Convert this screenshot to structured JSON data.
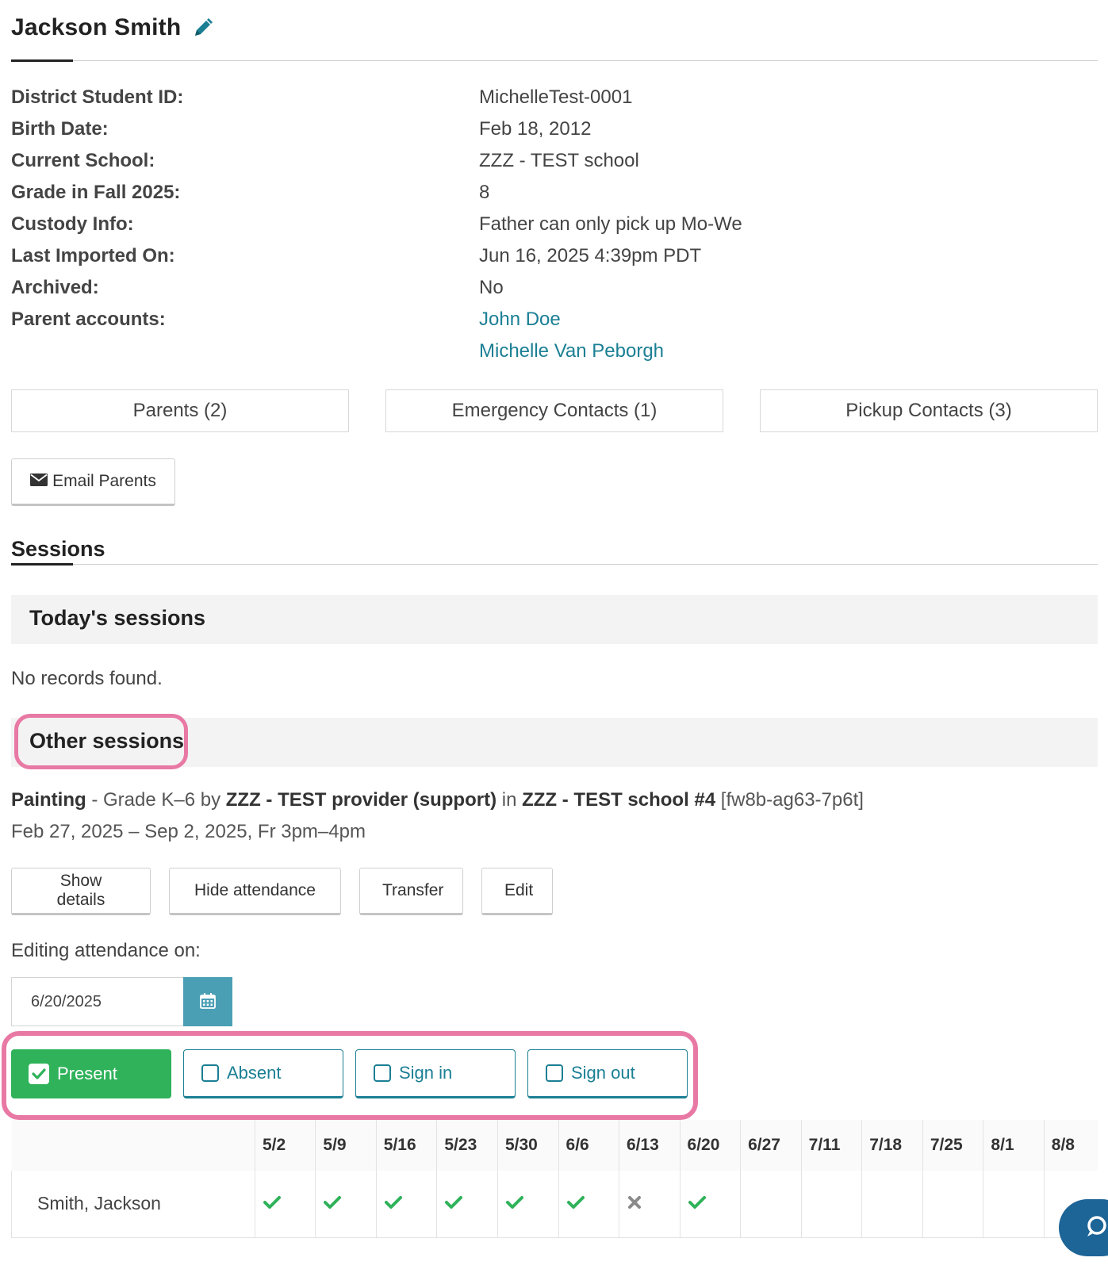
{
  "student": {
    "name": "Jackson Smith",
    "edit_icon": "pencil-icon",
    "fields": [
      {
        "label": "District Student ID:",
        "value": "MichelleTest-0001"
      },
      {
        "label": "Birth Date:",
        "value": "Feb 18, 2012"
      },
      {
        "label": "Current School:",
        "value": "ZZZ - TEST school"
      },
      {
        "label": "Grade in Fall 2025:",
        "value": "8"
      },
      {
        "label": "Custody Info:",
        "value": "Father can only pick up Mo-We"
      },
      {
        "label": "Last Imported On:",
        "value": "Jun 16, 2025 4:39pm PDT"
      },
      {
        "label": "Archived:",
        "value": "No"
      }
    ],
    "parent_accounts_label": "Parent accounts:",
    "parent_accounts": [
      "John Doe",
      "Michelle Van Peborgh"
    ]
  },
  "tabs": [
    "Parents (2)",
    "Emergency Contacts (1)",
    "Pickup Contacts (3)"
  ],
  "email_parents_label": "Email Parents",
  "sessions": {
    "title": "Sessions",
    "today_title": "Today's sessions",
    "no_records": "No records found.",
    "other_title": "Other sessions",
    "session": {
      "name": "Painting",
      "grade": " - Grade K–6 by ",
      "provider": "ZZZ - TEST provider (support)",
      "in_text": " in ",
      "school": "ZZZ - TEST school #4",
      "code": " [fw8b-ag63-7p6t]",
      "schedule": "Feb 27, 2025 – Sep 2, 2025, Fr 3pm–4pm"
    },
    "buttons": [
      "Show details",
      "Hide attendance",
      "Transfer",
      "Edit"
    ],
    "editing_label": "Editing attendance on:",
    "date_value": "6/20/2025",
    "attendance_options": [
      {
        "label": "Present",
        "checked": true
      },
      {
        "label": "Absent",
        "checked": false
      },
      {
        "label": "Sign in",
        "checked": false
      },
      {
        "label": "Sign out",
        "checked": false
      }
    ],
    "dates": [
      "5/2",
      "5/9",
      "5/16",
      "5/23",
      "5/30",
      "6/6",
      "6/13",
      "6/20",
      "6/27",
      "7/11",
      "7/18",
      "7/25",
      "8/1",
      "8/8"
    ],
    "student_row": {
      "name": "Smith, Jackson",
      "marks": [
        "check",
        "check",
        "check",
        "check",
        "check",
        "check",
        "x",
        "check",
        "",
        "",
        "",
        "",
        "",
        ""
      ]
    }
  },
  "colors": {
    "link": "#1b7f94",
    "present": "#2fb25a",
    "highlight": "#e879a4",
    "calendar": "#4a9fb5",
    "chat": "#1d6497"
  }
}
